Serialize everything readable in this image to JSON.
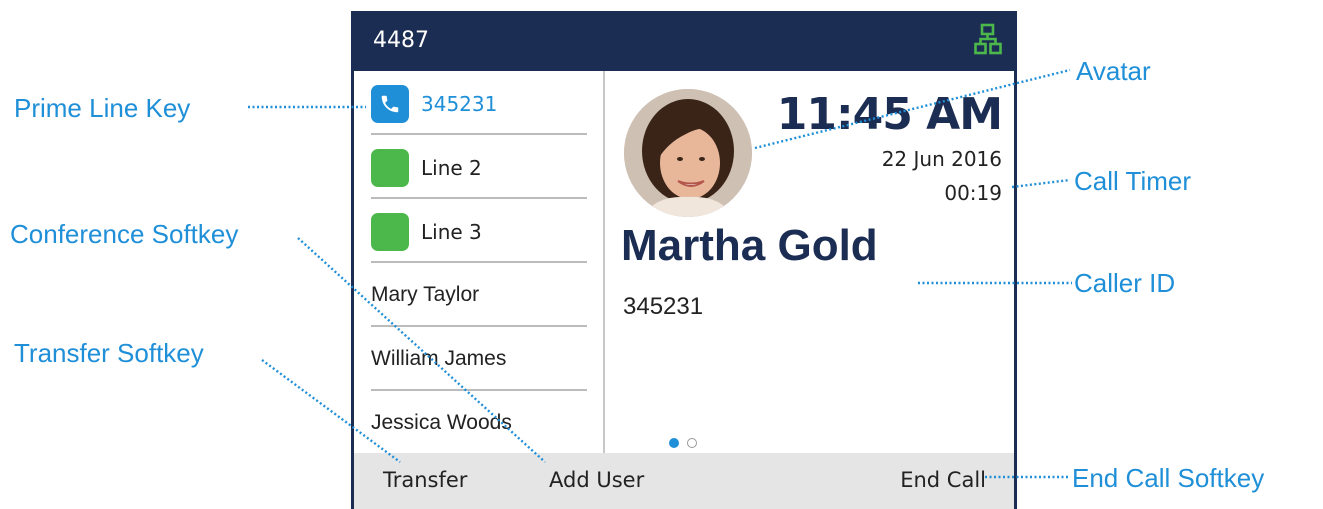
{
  "phone": {
    "extension": "4487",
    "network_icon": "network-icon",
    "lines": [
      {
        "label": "345231",
        "type": "prime",
        "icon": "phone-handset-icon",
        "color": "#1f8fd8"
      },
      {
        "label": "Line 2",
        "type": "line",
        "color": "#4cb84c"
      },
      {
        "label": "Line 3",
        "type": "line",
        "color": "#4cb84c"
      }
    ],
    "contacts": [
      {
        "label": "Mary Taylor"
      },
      {
        "label": "William James"
      },
      {
        "label": "Jessica Woods"
      }
    ],
    "call": {
      "time": "11:45 AM",
      "date": "22 Jun 2016",
      "timer": "00:19",
      "caller_name": "Martha Gold",
      "caller_number": "345231",
      "page_indicator": {
        "current": 1,
        "total": 2
      }
    },
    "softkeys": {
      "transfer": "Transfer",
      "add_user": "Add User",
      "end_call": "End Call"
    }
  },
  "callouts": {
    "prime_line_key": "Prime Line Key",
    "conference_softkey": "Conference Softkey",
    "transfer_softkey": "Transfer Softkey",
    "avatar": "Avatar",
    "call_timer": "Call Timer",
    "caller_id": "Caller ID",
    "end_call_softkey": "End Call Softkey"
  },
  "colors": {
    "header_navy": "#1b2d52",
    "accent_blue": "#1f8fd8",
    "line_green": "#4cb84c",
    "softkey_bar": "#e5e5e5"
  }
}
